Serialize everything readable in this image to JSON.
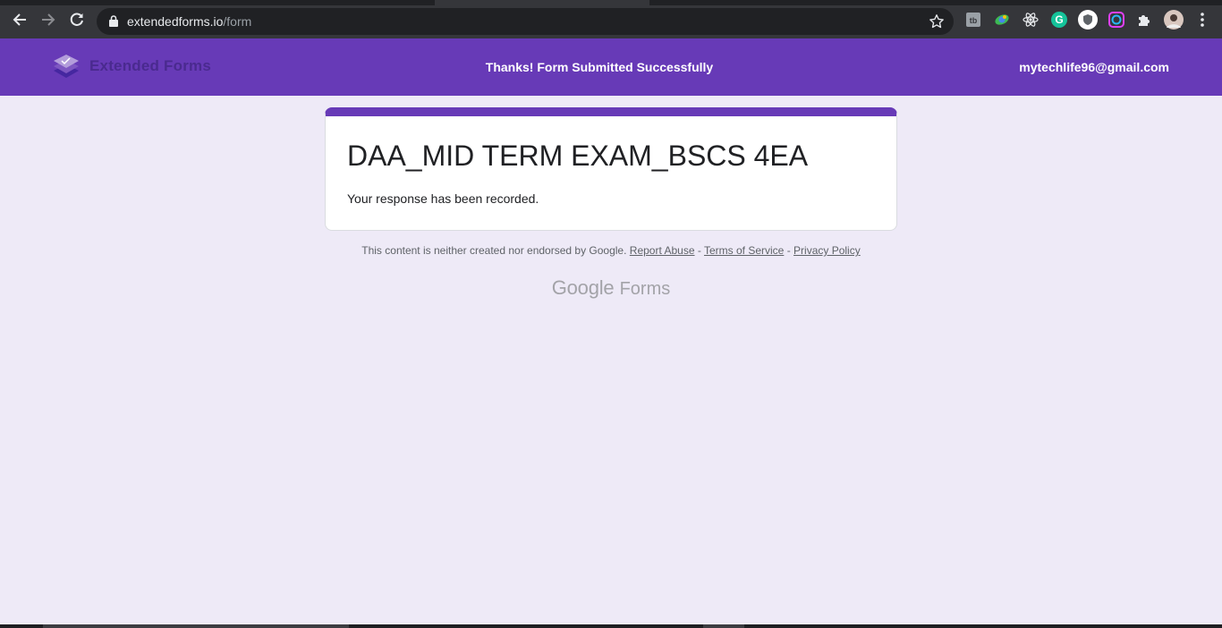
{
  "browser": {
    "url_domain": "extendedforms.io",
    "url_path": "/form"
  },
  "icons": {
    "back": "arrow-left-icon",
    "forward": "arrow-right-icon",
    "reload": "reload-icon",
    "lock": "lock-icon",
    "bookmark": "star-icon",
    "extensions": [
      "tb-extension-icon",
      "globe-extension-icon",
      "react-icon",
      "grammarly-icon",
      "shield-extension-icon",
      "color-ring-icon",
      "puzzle-icon"
    ],
    "profile": "avatar",
    "menu": "kebab-menu-icon"
  },
  "header": {
    "brand_name": "Extended Forms",
    "banner": "Thanks! Form Submitted Successfully",
    "account_email": "mytechlife96@gmail.com"
  },
  "card": {
    "title": "DAA_MID TERM EXAM_BSCS 4EA",
    "message": "Your response has been recorded."
  },
  "footer": {
    "disclaimer": "This content is neither created nor endorsed by Google.",
    "report_abuse": "Report Abuse",
    "separator": "-",
    "terms": "Terms of Service",
    "privacy": "Privacy Policy",
    "logo_google": "Google",
    "logo_forms": "Forms"
  },
  "colors": {
    "accent": "#673ab7",
    "page_bg": "#eeeaf7"
  }
}
